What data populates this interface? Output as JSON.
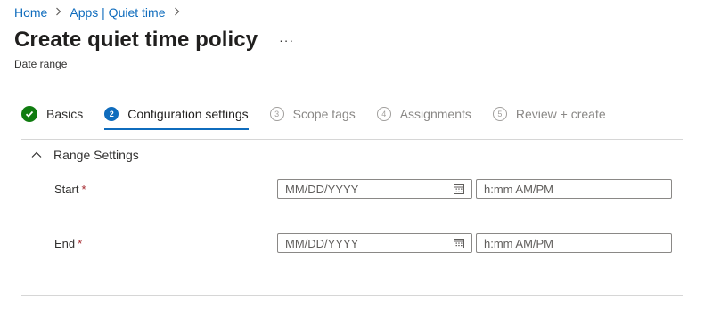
{
  "breadcrumb": {
    "items": [
      {
        "label": "Home"
      },
      {
        "label": "Apps | Quiet time"
      }
    ],
    "separator": ">"
  },
  "header": {
    "title": "Create quiet time policy",
    "more_label": "···",
    "subtitle": "Date range"
  },
  "wizard": {
    "steps": [
      {
        "num": "✓",
        "label": "Basics",
        "state": "done"
      },
      {
        "num": "2",
        "label": "Configuration settings",
        "state": "current"
      },
      {
        "num": "3",
        "label": "Scope tags",
        "state": "future"
      },
      {
        "num": "4",
        "label": "Assignments",
        "state": "future"
      },
      {
        "num": "5",
        "label": "Review + create",
        "state": "future"
      }
    ]
  },
  "section": {
    "title": "Range Settings",
    "expanded": true
  },
  "fields": {
    "start": {
      "label": "Start",
      "required": "*",
      "date_placeholder": "MM/DD/YYYY",
      "time_placeholder": "h:mm AM/PM"
    },
    "end": {
      "label": "End",
      "required": "*",
      "date_placeholder": "MM/DD/YYYY",
      "time_placeholder": "h:mm AM/PM"
    }
  },
  "icons": {
    "breadcrumb_separator": "chevron-right-icon",
    "section_toggle": "chevron-up-icon",
    "calendar": "calendar-icon",
    "step_done": "checkmark-icon"
  },
  "colors": {
    "accent": "#0f6cbd",
    "success": "#107c10",
    "required": "#a4262c",
    "inactive_text": "#8a8886"
  }
}
